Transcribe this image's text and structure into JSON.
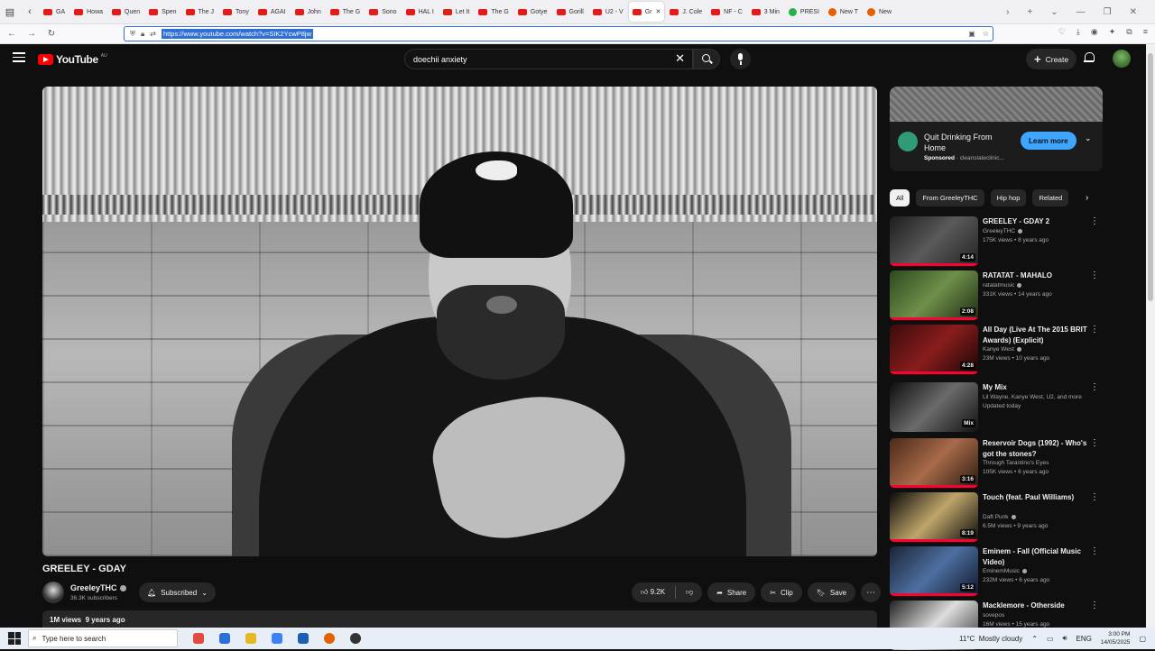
{
  "browser": {
    "tabs": [
      {
        "label": "GA",
        "fav": "yt"
      },
      {
        "label": "Howa",
        "fav": "yt"
      },
      {
        "label": "Quen",
        "fav": "yt"
      },
      {
        "label": "Spen",
        "fav": "yt"
      },
      {
        "label": "The J",
        "fav": "yt"
      },
      {
        "label": "Tony",
        "fav": "yt"
      },
      {
        "label": "AGAI",
        "fav": "yt"
      },
      {
        "label": "John",
        "fav": "yt"
      },
      {
        "label": "The G",
        "fav": "yt"
      },
      {
        "label": "Sono",
        "fav": "yt"
      },
      {
        "label": "HAL I",
        "fav": "yt"
      },
      {
        "label": "Let It",
        "fav": "yt"
      },
      {
        "label": "The G",
        "fav": "yt"
      },
      {
        "label": "Gotye",
        "fav": "yt"
      },
      {
        "label": "Gorill",
        "fav": "yt"
      },
      {
        "label": "U2 - V",
        "fav": "yt"
      },
      {
        "label": "Gr",
        "fav": "yt",
        "active": true
      },
      {
        "label": "J. Cole",
        "fav": "yt"
      },
      {
        "label": "NF - C",
        "fav": "yt"
      },
      {
        "label": "3 Min",
        "fav": "yt"
      },
      {
        "label": "PRESI",
        "fav": "g"
      },
      {
        "label": "New T",
        "fav": "ff"
      },
      {
        "label": "New",
        "fav": "ff"
      }
    ],
    "url": "https://www.youtube.com/watch?v=SIK2YcwP8jw"
  },
  "header": {
    "logo_text": "YouTube",
    "country": "AU",
    "search_value": "doechii anxiety",
    "create_label": "Create"
  },
  "video": {
    "title": "GREELEY - GDAY",
    "channel": "GreeleyTHC",
    "subscribers": "36.3K subscribers",
    "subscribed_label": "Subscribed",
    "likes": "9.2K",
    "share_label": "Share",
    "clip_label": "Clip",
    "save_label": "Save",
    "views_line": "1M views  9 years ago"
  },
  "ad": {
    "title": "Quit Drinking From Home",
    "sponsored": "Sponsored",
    "domain": "cleanslateclinic...",
    "cta": "Learn more"
  },
  "chips": [
    "All",
    "From GreeleyTHC",
    "Hip hop",
    "Related"
  ],
  "recommendations": [
    {
      "title": "GREELEY - GDAY 2",
      "channel": "GreeleyTHC",
      "verified": true,
      "meta": "175K views • 8 years ago",
      "duration": "4:14"
    },
    {
      "title": "RATATAT - MAHALO",
      "channel": "ratatatmusic",
      "verified": true,
      "meta": "331K views • 14 years ago",
      "duration": "2:08"
    },
    {
      "title": "All Day (Live At The 2015 BRIT Awards) (Explicit)",
      "channel": "Kanye West",
      "verified": true,
      "meta": "23M views • 10 years ago",
      "duration": "4:28"
    },
    {
      "title": "My Mix",
      "channel": "Lil Wayne, Kanye West, U2, and more",
      "verified": false,
      "meta": "Updated today",
      "duration": "Mix"
    },
    {
      "title": "Reservoir Dogs (1992) - Who's got the stones?",
      "channel": "Through Tarantino's Eyes",
      "verified": false,
      "meta": "105K views • 6 years ago",
      "duration": "3:16"
    },
    {
      "title": "Touch (feat. Paul Williams)",
      "channel": "Daft Punk",
      "verified": true,
      "meta": "6.5M views • 9 years ago",
      "duration": "8:19"
    },
    {
      "title": "Eminem - Fall (Official Music Video)",
      "channel": "EminemMusic",
      "verified": true,
      "meta": "232M views • 6 years ago",
      "duration": "5:12"
    },
    {
      "title": "Macklemore - Otherside",
      "channel": "sovepos",
      "verified": false,
      "meta": "16M views • 15 years ago",
      "duration": ""
    }
  ],
  "taskbar": {
    "search_placeholder": "Type here to search",
    "weather": "11°C  Mostly cloudy",
    "lang": "ENG",
    "time": "3:00 PM",
    "date": "14/05/2025"
  },
  "colors": {
    "bg": "#0f0f0f",
    "accent_red": "#ff0033",
    "link_blue": "#3ea6ff"
  }
}
